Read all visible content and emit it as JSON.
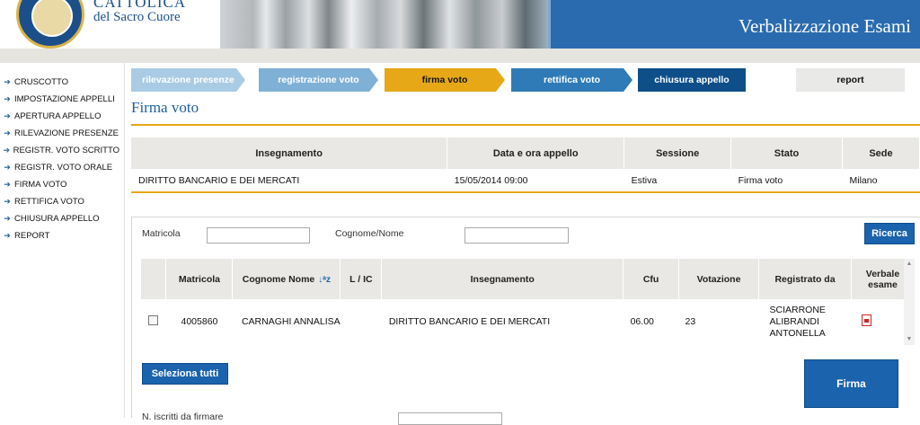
{
  "header": {
    "university_line1": "CATTOLICA",
    "university_line2": "del Sacro Cuore",
    "app_title": "Verbalizzazione Esami"
  },
  "sidebar": {
    "items": [
      {
        "label": "CRUSCOTTO"
      },
      {
        "label": "IMPOSTAZIONE APPELLI"
      },
      {
        "label": "APERTURA APPELLO"
      },
      {
        "label": "RILEVAZIONE PRESENZE"
      },
      {
        "label": "REGISTR. VOTO SCRITTO"
      },
      {
        "label": "REGISTR. VOTO ORALE"
      },
      {
        "label": "FIRMA VOTO"
      },
      {
        "label": "RETTIFICA VOTO"
      },
      {
        "label": "CHIUSURA APPELLO"
      },
      {
        "label": "REPORT"
      }
    ]
  },
  "steps": [
    {
      "label": "rilevazione presenze"
    },
    {
      "label": "registrazione voto"
    },
    {
      "label": "firma voto"
    },
    {
      "label": "rettifica voto"
    },
    {
      "label": "chiusura appello"
    },
    {
      "label": "report"
    }
  ],
  "page_title": "Firma voto",
  "info_table": {
    "headers": [
      "Insegnamento",
      "Data e ora appello",
      "Sessione",
      "Stato",
      "Sede"
    ],
    "row": [
      "DIRITTO BANCARIO E DEI MERCATI",
      "15/05/2014 09:00",
      "Estiva",
      "Firma voto",
      "Milano"
    ]
  },
  "search": {
    "matricola_label": "Matricola",
    "matricola_value": "",
    "nome_label": "Cognome/Nome",
    "nome_value": "",
    "button": "Ricerca"
  },
  "results": {
    "headers": [
      "",
      "Matricola",
      "Cognome Nome",
      "L / IC",
      "Insegnamento",
      "Cfu",
      "Votazione",
      "Registrato da",
      "Verbale esame"
    ],
    "rows": [
      {
        "matricola": "4005860",
        "nome": "CARNAGHI ANNALISA",
        "lic": "",
        "insegnamento": "DIRITTO BANCARIO E DEI MERCATI",
        "cfu": "06.00",
        "votazione": "23",
        "registrato_da": "SCIARRONE ALIBRANDI ANTONELLA",
        "checked": false
      }
    ]
  },
  "buttons": {
    "select_all": "Seleziona tutti",
    "sign": "Firma"
  },
  "bottom_label": "N. iscritti da firmare"
}
